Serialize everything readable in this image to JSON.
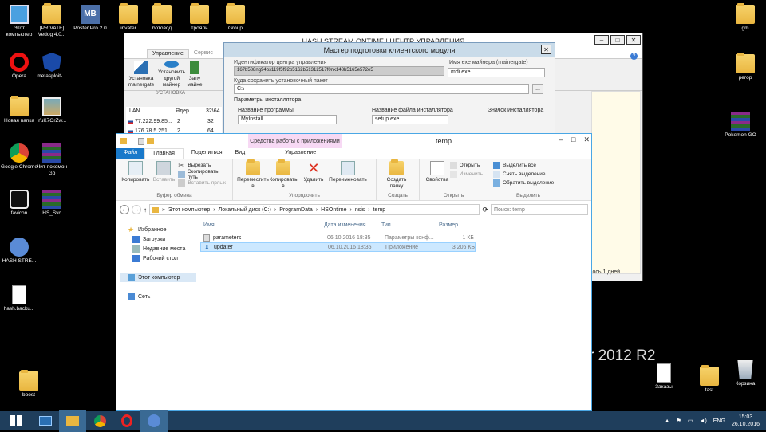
{
  "desktop_left": [
    {
      "label": "Этот компьютер",
      "icon": "computer-icon"
    },
    {
      "label": "[PRIVATE] Vedog 4.0...",
      "icon": "folder-icon"
    },
    {
      "label": "Poster Pro 2.0",
      "icon": "mb-app-icon"
    },
    {
      "label": "invater",
      "icon": "folder-icon"
    },
    {
      "label": "ботовод",
      "icon": "folder-icon"
    },
    {
      "label": "трояль",
      "icon": "folder-icon"
    },
    {
      "label": "Group",
      "icon": "folder-icon"
    },
    {
      "label": "Opera",
      "icon": "opera-icon"
    },
    {
      "label": "metasploit-...",
      "icon": "metasploit-icon"
    },
    {
      "label": "Новая папка",
      "icon": "folder-icon"
    },
    {
      "label": "YuK7OrZw...",
      "icon": "image-icon"
    },
    {
      "label": "Google Chrome",
      "icon": "chrome-icon"
    },
    {
      "label": "Чит покемон Go",
      "icon": "winrar-icon"
    },
    {
      "label": "favicon",
      "icon": "steam-icon"
    },
    {
      "label": "HS_Svc",
      "icon": "winrar-icon"
    },
    {
      "label": "HASH STRE...",
      "icon": "wifi-app-icon"
    },
    {
      "label": "hash.backu...",
      "icon": "file-icon"
    },
    {
      "label": "boost",
      "icon": "folder-icon"
    }
  ],
  "desktop_right": [
    {
      "label": "gm",
      "icon": "folder-icon"
    },
    {
      "label": "perop",
      "icon": "folder-icon"
    },
    {
      "label": "Pokemon GO",
      "icon": "winrar-icon"
    },
    {
      "label": "Заказы",
      "icon": "file-icon"
    },
    {
      "label": "tast",
      "icon": "folder-icon"
    },
    {
      "label": "Корзина",
      "icon": "recycle-bin-icon"
    }
  ],
  "watermark": "r 2012 R2",
  "back_window": {
    "title": "HASH STREAM ONTIME | ЦЕНТР УПРАВЛЕНИЯ",
    "tabs": [
      "Управление",
      "Сервис"
    ],
    "ribbon_buttons": [
      "Установка mainergate",
      "Установить другой майнер",
      "Запу майне"
    ],
    "group_label": "УСТАНОВКА",
    "table_headers": [
      "LAN",
      "Ядер",
      "32\\64"
    ],
    "rows": [
      {
        "lan": "77.222.99.85...",
        "cores": "2",
        "arch": "32"
      },
      {
        "lan": "176.78.5.251...",
        "cores": "2",
        "arch": "64"
      }
    ],
    "status_tail": "ось 1 дней."
  },
  "wizard": {
    "title": "Мастер подготовки клиентского модуля",
    "center_id_label": "Идентификатор центра управления",
    "center_id_value": "167b588ng94bs119f5f92b5162b51312517f0nk148b5165e572e5",
    "exe_label": "Имя exe майнера (mainergate)",
    "exe_value": "mdi.exe",
    "save_label": "Куда сохранить установочный пакет",
    "save_value": "C:\\",
    "browse": "...",
    "params_label": "Параметры инсталлятора",
    "program_name_label": "Название программы",
    "program_name_value": "MyInstall",
    "installer_file_label": "Название файла инсталлятора",
    "installer_file_value": "setup.exe",
    "installer_icon_label": "Значок инсталлятора"
  },
  "explorer": {
    "title": "temp",
    "context_tab": "Средства работы с приложениями",
    "tabs": [
      "Файл",
      "Главная",
      "Поделиться",
      "Вид",
      "Управление"
    ],
    "ribbon": {
      "clipboard": {
        "copy": "Копировать",
        "paste": "Вставить",
        "cut": "Вырезать",
        "copy_path": "Скопировать путь",
        "paste_shortcut": "Вставить ярлык",
        "label": "Буфер обмена"
      },
      "organize": {
        "move": "Переместить в",
        "copy_to": "Копировать в",
        "delete": "Удалить",
        "rename": "Переименовать",
        "label": "Упорядочить"
      },
      "create": {
        "new_folder": "Создать папку",
        "label": "Создать"
      },
      "open": {
        "properties": "Свойства",
        "open": "Открыть",
        "edit": "Изменить",
        "label": "Открыть"
      },
      "select": {
        "select_all": "Выделить все",
        "deselect": "Снять выделение",
        "invert": "Обратить выделение",
        "label": "Выделить"
      }
    },
    "breadcrumb": [
      "Этот компьютер",
      "Локальный диск (C:)",
      "ProgramData",
      "HSOntime",
      "nsis",
      "temp"
    ],
    "search_placeholder": "Поиск: temp",
    "nav": {
      "favorites": "Избранное",
      "downloads": "Загрузки",
      "recent": "Недавние места",
      "desktop": "Рабочий стол",
      "this_pc": "Этот компьютер",
      "network": "Сеть"
    },
    "columns": [
      "Имя",
      "Дата изменения",
      "Тип",
      "Размер"
    ],
    "files": [
      {
        "name": "parameters",
        "date": "06.10.2016 18:35",
        "type": "Параметры конф...",
        "size": "1 КБ"
      },
      {
        "name": "updater",
        "date": "06.10.2016 18:35",
        "type": "Приложение",
        "size": "3 206 КБ"
      }
    ]
  },
  "taskbar": {
    "lang": "ENG",
    "time": "15:03",
    "date": "26.10.2016"
  }
}
